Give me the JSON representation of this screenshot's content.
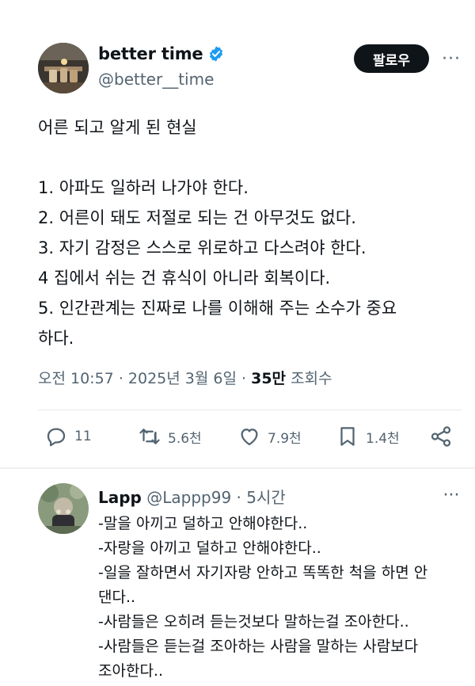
{
  "post": {
    "display_name": "better time",
    "handle": "@better__time",
    "follow_label": "팔로우",
    "more_label": "···",
    "body_title": "어른 되고 알게 된 현실",
    "body_lines": [
      "1. 아파도 일하러 나가야 한다.",
      "2. 어른이 돼도 저절로 되는 건 아무것도 없다.",
      "3. 자기 감정은 스스로 위로하고 다스려야 한다.",
      "4 집에서 쉬는 건 휴식이 아니라 회복이다.",
      "5. 인간관계는 진짜로 나를 이해해 주는 소수가 중요",
      "하다."
    ],
    "time": "오전 10:57",
    "date": "2025년 3월 6일",
    "views_count": "35만",
    "views_label": "조회수",
    "meta_separator": "·"
  },
  "actions": {
    "replies": "11",
    "reposts": "5.6천",
    "likes": "7.9천",
    "bookmarks": "1.4천"
  },
  "reply": {
    "display_name": "Lapp",
    "handle": "@Lappp99",
    "separator": "·",
    "time": "5시간",
    "more_label": "···",
    "lines": [
      "-말을 아끼고 덜하고 안해야한다..",
      "-자랑을 아끼고 덜하고 안해야한다..",
      "-일을 잘하면서 자기자랑 안하고 똑똑한 척을 하면 안",
      "댄다..",
      "-사람들은 오히려 듣는것보다 말하는걸 조아한다..",
      "-사람들은 듣는걸 조아하는 사람을 말하는 사람보다",
      "조아한다.."
    ]
  },
  "colors": {
    "text": "#0f1419",
    "secondary": "#536471",
    "verified": "#1d9bf0",
    "follow_bg": "#0f1419"
  },
  "icons": [
    "verified-badge-icon",
    "more-icon",
    "reply-icon",
    "repost-icon",
    "like-icon",
    "bookmark-icon",
    "share-icon"
  ]
}
